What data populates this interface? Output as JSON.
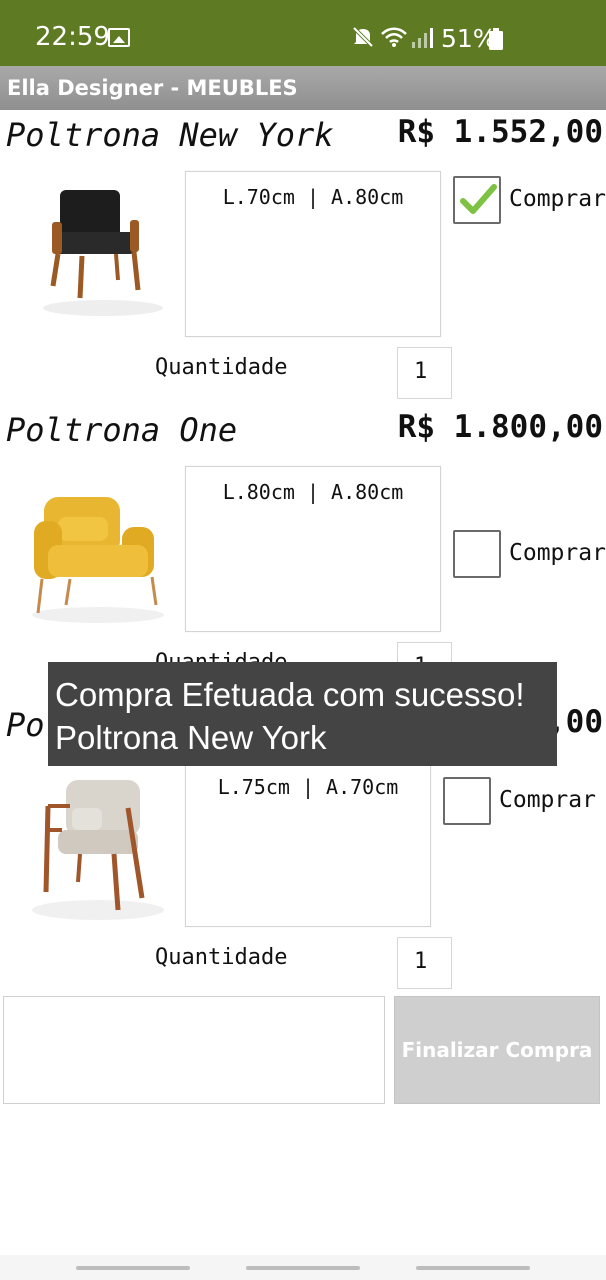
{
  "status_bar": {
    "time": "22:59",
    "battery": "51%",
    "icons": [
      "image-icon",
      "mute-icon",
      "wifi-icon",
      "signal-icon",
      "battery-icon"
    ],
    "background": "#5e7a22"
  },
  "app": {
    "title": "Ella Designer - MEUBLES"
  },
  "products": [
    {
      "name": "Poltrona New York",
      "price": "R$ 1.552,00",
      "dimensions": "L.70cm | A.80cm",
      "buy_label": "Comprar",
      "checked": true,
      "quantity_label": "Quantidade",
      "quantity": "1",
      "image": "black-armchair-image"
    },
    {
      "name": "Poltrona One",
      "price": "R$ 1.800,00",
      "dimensions": "L.80cm | A.80cm",
      "buy_label": "Comprar",
      "checked": false,
      "quantity_label": "Quantidade",
      "quantity": "1",
      "image": "yellow-armchair-image"
    },
    {
      "name": "Poltrona",
      "price": "R$ ,00",
      "dimensions": "L.75cm | A.70cm",
      "buy_label": "Comprar",
      "checked": false,
      "quantity_label": "Quantidade",
      "quantity": "1",
      "image": "beige-wood-chair-image"
    }
  ],
  "footer": {
    "notes_value": "",
    "finish_button_label": "Finalizar Compra"
  },
  "toast": {
    "message": "Compra Efetuada com sucesso! Poltrona New York"
  },
  "colors": {
    "accent_check": "#7dc242",
    "title_bar": "#999999",
    "toast": "#444444"
  }
}
